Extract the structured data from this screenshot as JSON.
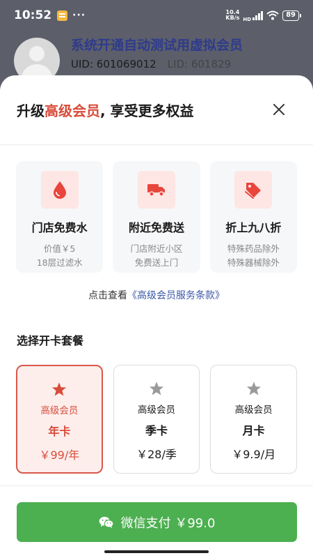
{
  "status_bar": {
    "time": "10:52",
    "dots": "···",
    "speed_top": "10.4",
    "speed_bottom": "KB/s",
    "hd": "HD",
    "battery": "89"
  },
  "background": {
    "name": "系统开通自动测试用虚拟会员",
    "uid": "UID: 601069012",
    "lid": "LID: 601829"
  },
  "sheet": {
    "title_prefix": "升级",
    "title_highlight": "高级会员",
    "title_suffix": ", 享受更多权益",
    "close_icon": "close-icon"
  },
  "benefits": [
    {
      "icon": "water-drop-icon",
      "title": "门店免费水",
      "desc1": "价值￥5",
      "desc2": "18层过滤水"
    },
    {
      "icon": "truck-icon",
      "title": "附近免费送",
      "desc1": "门店附近小区",
      "desc2": "免费送上门"
    },
    {
      "icon": "tag-icon",
      "title": "折上九八折",
      "desc1": "特殊药品除外",
      "desc2": "特殊器械除外"
    }
  ],
  "terms": {
    "prefix": "点击查看",
    "link": "《高级会员服务条款》"
  },
  "plan_section_title": "选择开卡套餐",
  "plans": [
    {
      "label": "高级会员",
      "name": "年卡",
      "price": "￥99/年",
      "selected": true
    },
    {
      "label": "高级会员",
      "name": "季卡",
      "price": "￥28/季",
      "selected": false
    },
    {
      "label": "高级会员",
      "name": "月卡",
      "price": "￥9.9/月",
      "selected": false
    }
  ],
  "pay_button": {
    "label": "微信支付 ￥99.0",
    "icon": "wechat-icon"
  },
  "colors": {
    "accent": "#d84c3a",
    "pay_green": "#4caf50",
    "link_blue": "#3a57a6",
    "star_selected": "#d84c3a",
    "star_unselected": "#9a9a9a"
  }
}
